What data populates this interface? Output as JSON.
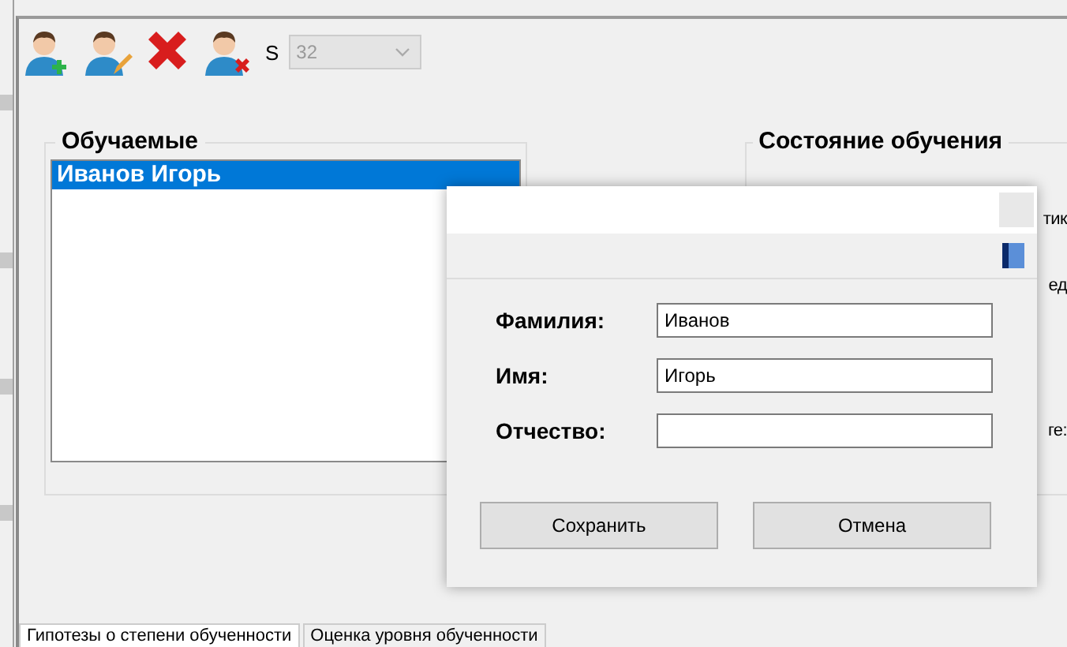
{
  "toolbar": {
    "buttons": [
      {
        "kind": "add-user"
      },
      {
        "kind": "edit-user"
      },
      {
        "kind": "delete"
      },
      {
        "kind": "remove-user"
      }
    ],
    "size_label": "S",
    "size_combo": {
      "value": "32",
      "disabled": true
    }
  },
  "learners_group": {
    "title": "Обучаемые",
    "items": [
      {
        "label": "Иванов Игорь",
        "selected": true
      }
    ]
  },
  "status_group": {
    "title": "Состояние обучения",
    "fragments": [
      "тик",
      "ед",
      "ге:"
    ]
  },
  "dialog": {
    "fields": [
      {
        "label": "Фамилия:",
        "value": "Иванов"
      },
      {
        "label": "Имя:",
        "value": "Игорь"
      },
      {
        "label": "Отчество:"
      }
    ],
    "buttons": [
      "Сохранить",
      "Отмена"
    ]
  },
  "tabs": [
    {
      "label": "Гипотезы о степени обученности",
      "selected": true
    },
    {
      "label": "Оценка уровня обученности",
      "selected": false
    }
  ]
}
